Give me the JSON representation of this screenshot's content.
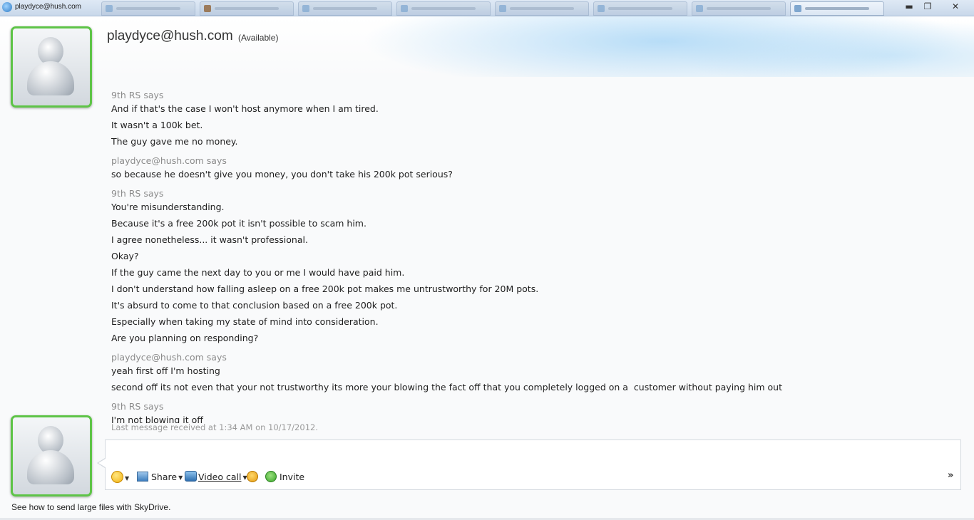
{
  "window": {
    "title": "playdyce@hush.com",
    "controls": {
      "minimize": "▬",
      "restore": "❐",
      "close": "✕"
    },
    "tab_count": 8
  },
  "header": {
    "contact_name": "playdyce@hush.com",
    "status": "(Available)"
  },
  "conversation": {
    "messages": [
      {
        "sender": "9th RS says",
        "lines": [
          "And if that's the case I won't host anymore when I am tired.",
          "It wasn't a 100k bet.",
          "The guy gave me no money."
        ]
      },
      {
        "sender": "playdyce@hush.com says",
        "lines": [
          "so because he doesn't give you money, you don't take his 200k pot serious?"
        ]
      },
      {
        "sender": "9th RS says",
        "lines": [
          "You're misunderstanding.",
          "Because it's a free 200k pot it isn't possible to scam him.",
          "I agree nonetheless... it wasn't professional.",
          "Okay?",
          "If the guy came the next day to you or me I would have paid him.",
          "I don't understand how falling asleep on a free 200k pot makes me untrustworthy for 20M pots.",
          "It's absurd to come to that conclusion based on a free 200k pot.",
          "Especially when taking my state of mind into consideration.",
          "Are you planning on responding?"
        ]
      },
      {
        "sender": "playdyce@hush.com says",
        "lines": [
          "yeah first off I'm hosting",
          "second off its not even that your not trustworthy its more your blowing the fact off that you completely logged on a  customer without paying him out"
        ]
      },
      {
        "sender": "9th RS says",
        "lines": [
          "I'm not blowing it off"
        ]
      }
    ],
    "last_received": "Last message received at 1:34 AM on 10/17/2012."
  },
  "input": {
    "value": "",
    "toolbar": {
      "share_label": "Share",
      "video_call_label": "Video call",
      "invite_label": "Invite",
      "more_label": "»"
    }
  },
  "footer": {
    "skydrive_link": "See how to send large files with SkyDrive."
  },
  "colors": {
    "avatar_border": "#5ec447",
    "sender_text": "#8b8b8b",
    "message_text": "#1e1e1e"
  },
  "icons": [
    "contact-avatar-icon",
    "emoticon-icon",
    "share-icon",
    "video-call-icon",
    "nudge-icon",
    "invite-icon"
  ]
}
